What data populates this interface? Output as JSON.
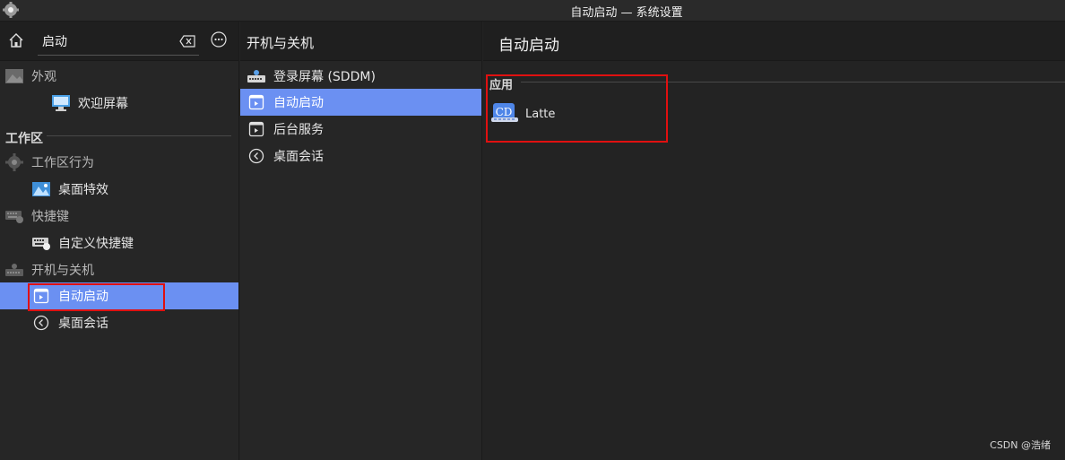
{
  "window": {
    "title": "自动启动 — 系统设置",
    "app_icon": "gear-icon"
  },
  "left": {
    "home_icon": "home-icon",
    "search": {
      "value": "启动",
      "placeholder": ""
    },
    "clear_icon": "backspace-clear-icon",
    "more_icon": "more-options-icon",
    "items": [
      {
        "label": "外观",
        "icon": "appearance-icon",
        "type": "category"
      },
      {
        "label": "欢迎屏幕",
        "icon": "welcome-screen-icon",
        "type": "item"
      },
      {
        "label": "工作区",
        "type": "section"
      },
      {
        "label": "工作区行为",
        "icon": "workspace-behavior-icon",
        "type": "category"
      },
      {
        "label": "桌面特效",
        "icon": "desktop-effects-icon",
        "type": "item"
      },
      {
        "label": "快捷键",
        "icon": "keyboard-icon",
        "type": "category"
      },
      {
        "label": "自定义快捷键",
        "icon": "custom-shortcuts-icon",
        "type": "item"
      },
      {
        "label": "开机与关机",
        "icon": "startup-shutdown-icon",
        "type": "category"
      },
      {
        "label": "自动启动",
        "icon": "autostart-icon",
        "type": "item",
        "selected": true
      },
      {
        "label": "桌面会话",
        "icon": "session-icon",
        "type": "item"
      }
    ]
  },
  "middle": {
    "title": "开机与关机",
    "items": [
      {
        "label": "登录屏幕 (SDDM)",
        "icon": "login-screen-icon"
      },
      {
        "label": "自动启动",
        "icon": "autostart-icon",
        "selected": true
      },
      {
        "label": "后台服务",
        "icon": "background-services-icon"
      },
      {
        "label": "桌面会话",
        "icon": "session-icon"
      }
    ]
  },
  "right": {
    "title": "自动启动",
    "section": "应用",
    "apps": [
      {
        "label": "Latte",
        "icon": "latte-dock-icon"
      }
    ]
  },
  "watermark": "CSDN @浩绪",
  "colors": {
    "selection": "#6b90f2",
    "annotation_box": "#e01010",
    "background": "#232323"
  }
}
